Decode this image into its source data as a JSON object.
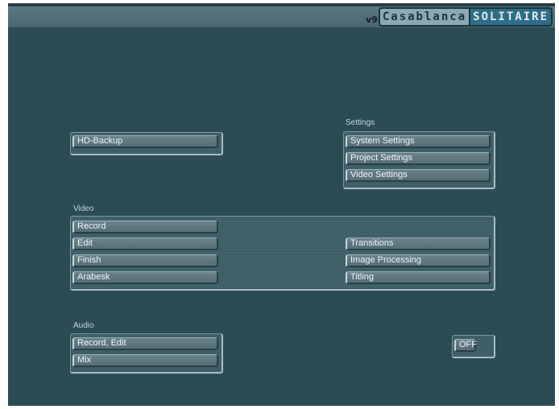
{
  "logo": {
    "version": "v9",
    "name": "Casablanca",
    "product": "SOLITAIRE"
  },
  "hd_backup": {
    "label": "HD-Backup"
  },
  "settings": {
    "title": "Settings",
    "system": "System Settings",
    "project": "Project Settings",
    "video": "Video Settings"
  },
  "video": {
    "title": "Video",
    "record": "Record",
    "edit": "Edit",
    "finish": "Finish",
    "arabesk": "Arabesk",
    "transitions": "Transitions",
    "image_processing": "Image Processing",
    "titling": "Titling"
  },
  "audio": {
    "title": "Audio",
    "record_edit": "Record, Edit",
    "mix": "Mix"
  },
  "toggle": {
    "label": "OFF"
  }
}
